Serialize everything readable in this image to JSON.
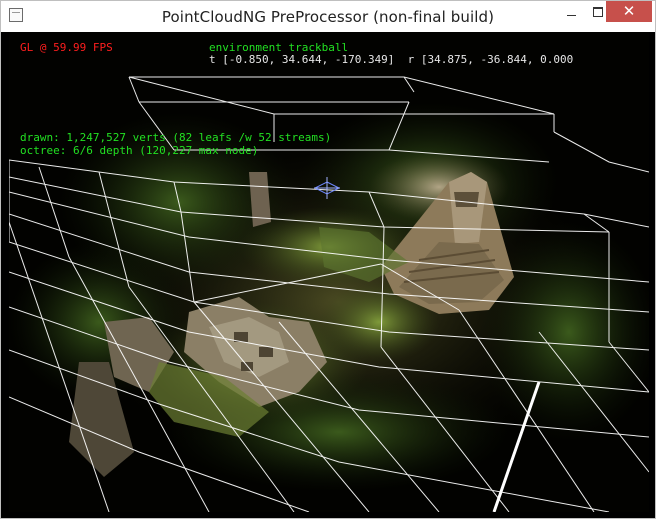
{
  "window": {
    "title": "PointCloudNG PreProcessor (non-final build)",
    "controls": {
      "minimize": "—",
      "maximize": "□",
      "close": "✕"
    }
  },
  "overlay": {
    "fps": "GL @ 59.99 FPS",
    "mode": "environment trackball",
    "transform": "t [-0.850, 34.644, -170.349]  r [34.875, -36.844, 0.000",
    "drawn": "drawn: 1,247,527 verts (82 leafs /w 52 streams)",
    "octree": "octree: 6/6 depth (120,227 max node)"
  },
  "colors": {
    "fps_text": "#ff1e1e",
    "status_text": "#22e022",
    "transform_text": "#e6e6e6",
    "wireframe": "#ffffff",
    "close_button": "#c7504b"
  }
}
